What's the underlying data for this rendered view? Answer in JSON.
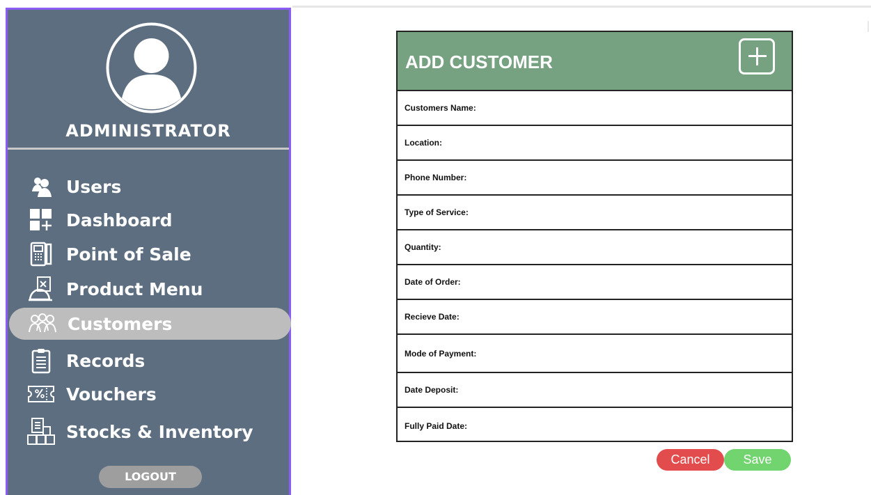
{
  "sidebar": {
    "role_title": "ADMINISTRATOR",
    "logout_label": "LOGOUT",
    "items": [
      {
        "label": "Users",
        "icon": "users-icon"
      },
      {
        "label": "Dashboard",
        "icon": "dashboard-icon"
      },
      {
        "label": "Point of Sale",
        "icon": "point-of-sale-icon"
      },
      {
        "label": "Product Menu",
        "icon": "product-menu-icon"
      },
      {
        "label": "Customers",
        "icon": "customers-icon",
        "active": true
      },
      {
        "label": "Records",
        "icon": "records-icon"
      },
      {
        "label": "Vouchers",
        "icon": "vouchers-icon"
      },
      {
        "label": "Stocks & Inventory",
        "icon": "stocks-inventory-icon"
      }
    ]
  },
  "form": {
    "title": "ADD CUSTOMER",
    "fields": [
      {
        "label": "Customers Name:"
      },
      {
        "label": "Location:"
      },
      {
        "label": "Phone Number:"
      },
      {
        "label": "Type of Service:"
      },
      {
        "label": "Quantity:"
      },
      {
        "label": "Date of Order:"
      },
      {
        "label": "Recieve Date:"
      },
      {
        "label": "Mode of Payment:"
      },
      {
        "label": "Date Deposit:"
      },
      {
        "label": "Fully Paid Date:"
      }
    ],
    "cancel_label": "Cancel",
    "save_label": "Save"
  },
  "colors": {
    "sidebar": "#5d6e80",
    "sidebar_border": "#8b5cf6",
    "header": "#76a282",
    "cancel": "#e24c4c",
    "save": "#72d46f",
    "active_item": "#bdbdbd"
  }
}
